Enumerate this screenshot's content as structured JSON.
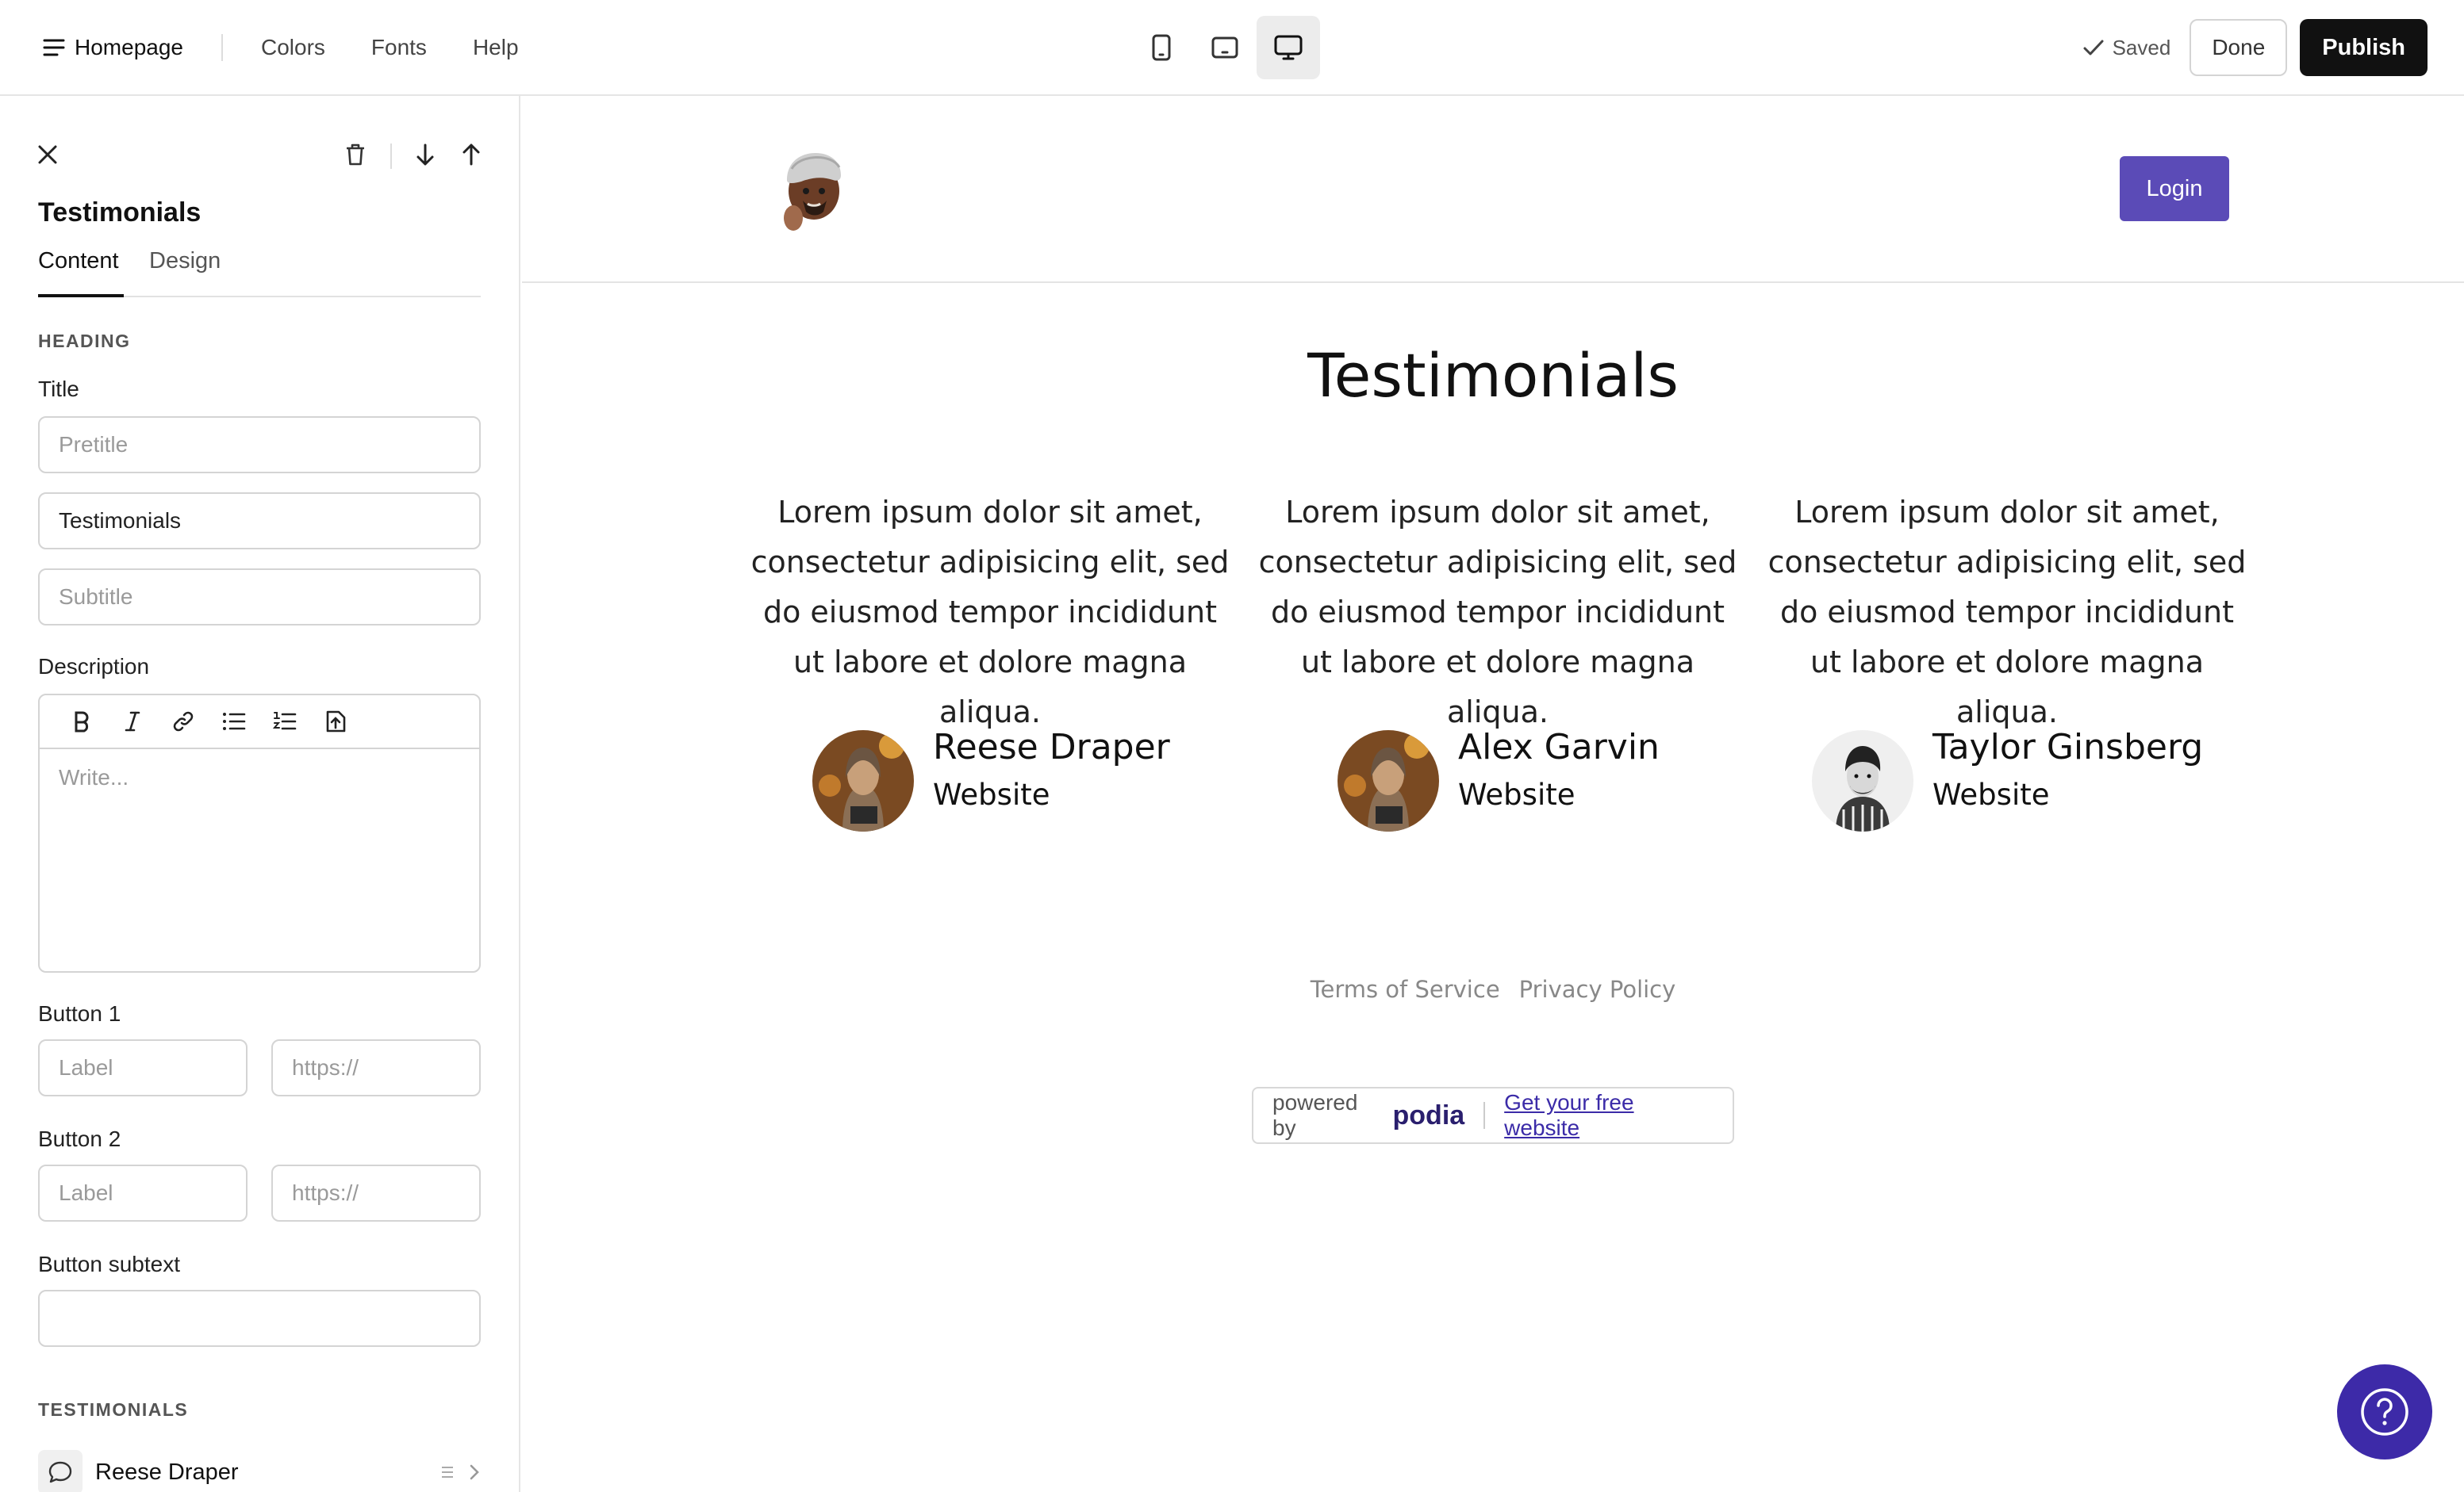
{
  "topbar": {
    "home_label": "Homepage",
    "links": [
      "Colors",
      "Fonts",
      "Help"
    ],
    "devices": [
      "mobile-icon",
      "tablet-icon",
      "desktop-icon"
    ],
    "active_device": "desktop",
    "saved_label": "Saved",
    "done_label": "Done",
    "publish_label": "Publish"
  },
  "sidebar": {
    "title": "Testimonials",
    "tabs": [
      "Content",
      "Design"
    ],
    "active_tab": "Content",
    "heading_section": "HEADING",
    "title_label": "Title",
    "pretitle_placeholder": "Pretitle",
    "title_value": "Testimonials",
    "subtitle_placeholder": "Subtitle",
    "description_label": "Description",
    "description_placeholder": "Write...",
    "button1_label": "Button 1",
    "button2_label": "Button 2",
    "button_label_placeholder": "Label",
    "button_url_placeholder": "https://",
    "button_subtext_label": "Button subtext",
    "button_subtext_value": "",
    "testimonials_section": "TESTIMONIALS",
    "testimonial_items": [
      "Reese Draper"
    ]
  },
  "preview": {
    "login_label": "Login",
    "title": "Testimonials",
    "testimonials": [
      {
        "quote": "Lorem ipsum dolor sit amet, consectetur adipisicing elit, sed do eiusmod tempor incididunt ut labore et dolore magna aliqua.",
        "name": "Reese Draper",
        "link": "Website"
      },
      {
        "quote": "Lorem ipsum dolor sit amet, consectetur adipisicing elit, sed do eiusmod tempor incididunt ut labore et dolore magna aliqua.",
        "name": "Alex Garvin",
        "link": "Website"
      },
      {
        "quote": "Lorem ipsum dolor sit amet, consectetur adipisicing elit, sed do eiusmod tempor incididunt ut labore et dolore magna aliqua.",
        "name": "Taylor Ginsberg",
        "link": "Website"
      }
    ],
    "footer_links": [
      "Terms of Service",
      "Privacy Policy"
    ],
    "powered_by": "powered by",
    "brand": "podia",
    "cta": "Get your free website"
  },
  "colors": {
    "accent": "#5b4bb7",
    "publish": "#111111",
    "help_fab": "#3d2aa8"
  }
}
